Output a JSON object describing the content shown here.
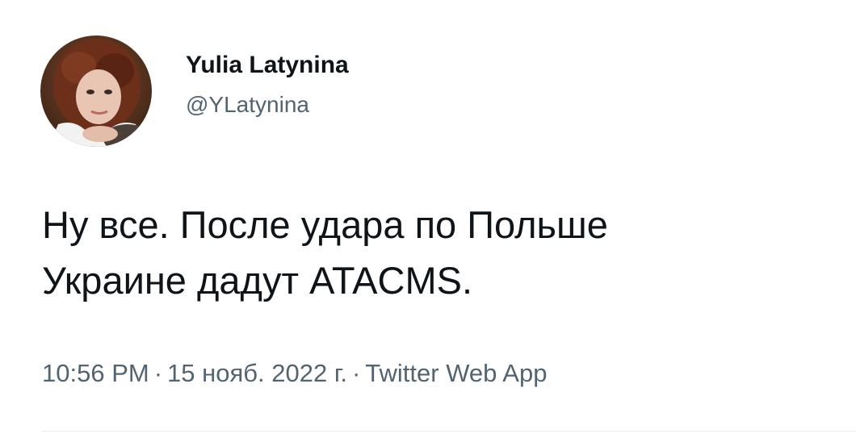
{
  "author": {
    "display_name": "Yulia Latynina",
    "handle": "@YLatynina",
    "avatar_icon": "profile-photo"
  },
  "tweet": {
    "text": "Ну все. После удара по Польше\nУкраине дадут ATACMS."
  },
  "meta": {
    "time": "10:56 PM",
    "separator": "·",
    "date": "15 нояб. 2022 г.",
    "source": "Twitter Web App"
  },
  "colors": {
    "primary_text": "#0f1419",
    "secondary_text": "#536471",
    "divider": "#e6ecf0"
  }
}
